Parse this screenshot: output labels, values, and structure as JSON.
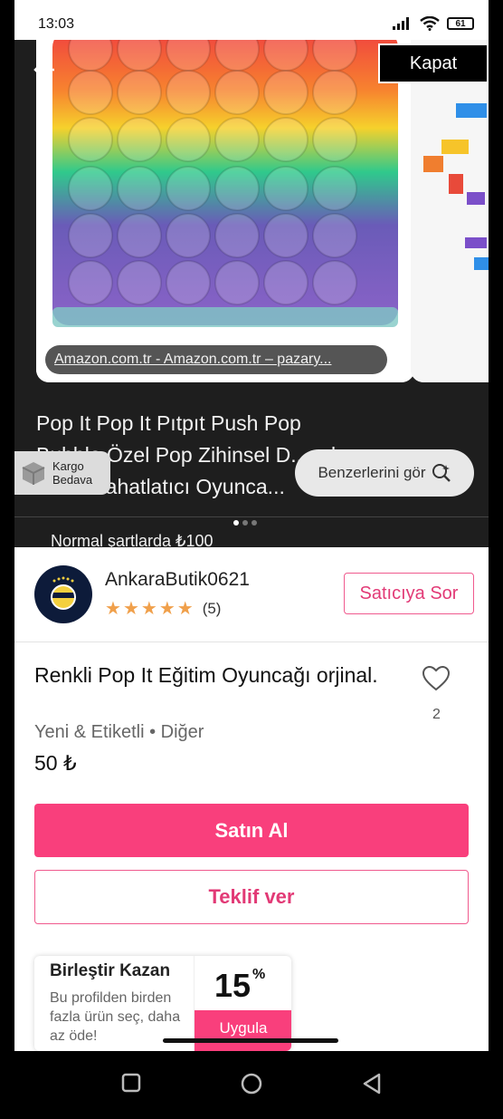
{
  "status": {
    "time": "13:03",
    "battery": "61"
  },
  "gallery": {
    "close_label": "Kapat",
    "source": "Amazon.com.tr - Amazon.com.tr – pazary...",
    "title_line1": "Pop It Pop It Pıtpıt Push Pop",
    "title_line2": "Bubble Özel Pop Zihinsel D... ...l",
    "title_line3": "Stres Rahatlatıcı Oyunca...",
    "cargo_line1": "Kargo",
    "cargo_line2": "Bedava",
    "similar_label": "Benzerlerini gör",
    "normal_text": "Normal şartlarda ₺100"
  },
  "seller": {
    "name": "AnkaraButik0621",
    "rating_count": "(5)",
    "stars": 5,
    "ask_label": "Satıcıya Sor"
  },
  "product": {
    "title": "Renkli Pop It Eğitim Oyuncağı orjinal.",
    "meta": "Yeni & Etiketli • Diğer",
    "price": "50 ₺",
    "likes": "2"
  },
  "actions": {
    "buy": "Satın Al",
    "offer": "Teklif ver"
  },
  "promo": {
    "title": "Birleştir Kazan",
    "desc": "Bu profilden birden fazla ürün seç, daha az öde!",
    "percent": "15",
    "percent_sign": "%",
    "apply": "Uygula"
  },
  "colors": {
    "accent": "#f93f7c",
    "star": "#f0a04b"
  },
  "icons": [
    "back-arrow-icon",
    "package-icon",
    "search-image-icon",
    "heart-icon",
    "checkmark-icon",
    "chevron-down-icon",
    "wifi-icon",
    "signal-icon",
    "battery-icon",
    "nav-back-icon",
    "nav-home-icon",
    "nav-recents-icon"
  ]
}
